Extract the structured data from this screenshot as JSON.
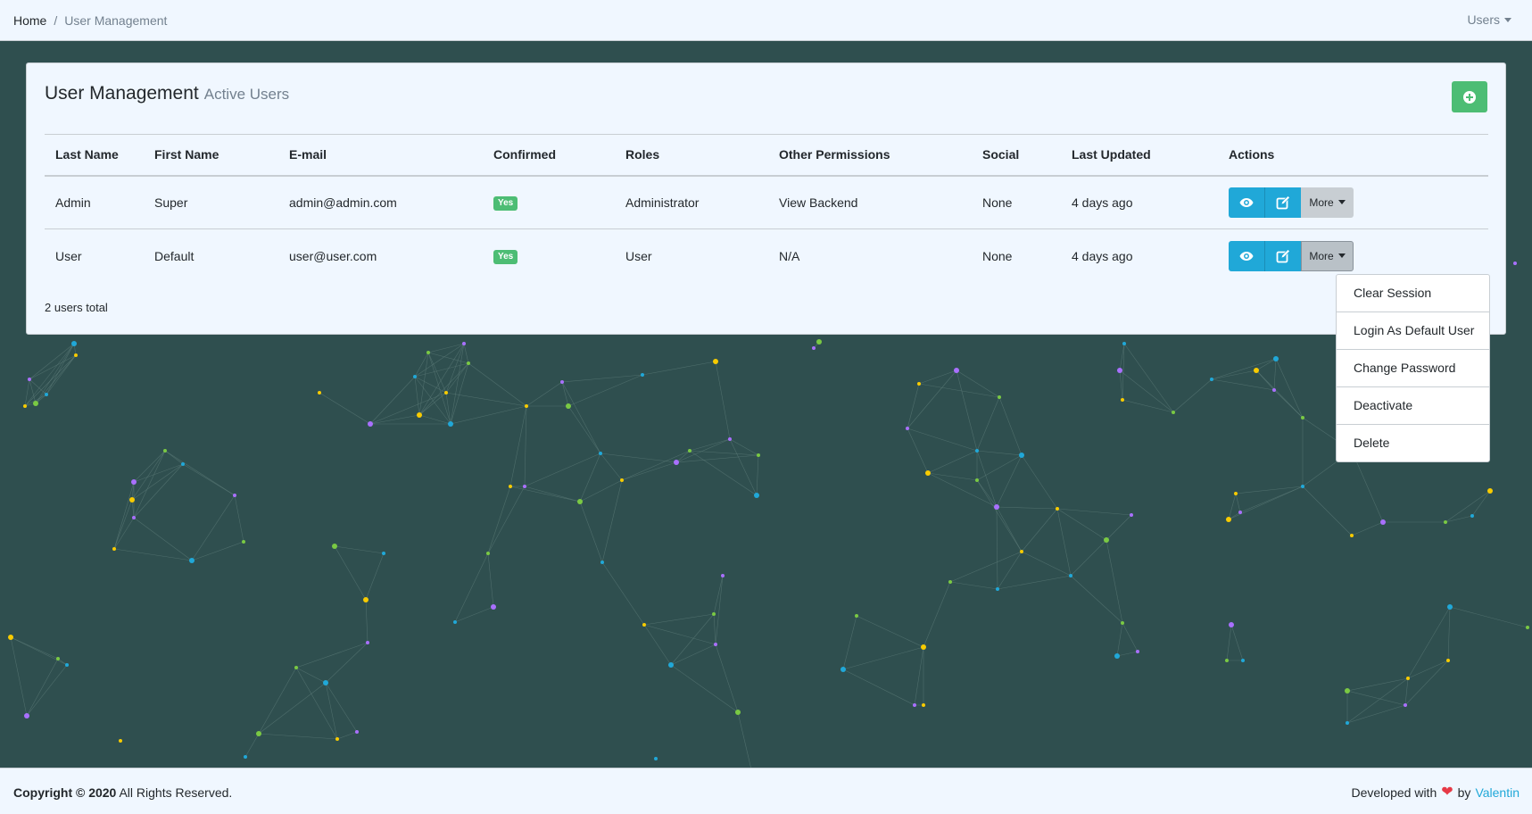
{
  "header": {
    "breadcrumb": {
      "home": "Home",
      "separator": "/",
      "current": "User Management"
    },
    "users_menu": "Users"
  },
  "card": {
    "title": "User Management",
    "subtitle": "Active Users",
    "add_button_icon": "plus-circle-icon",
    "total": "2 users total"
  },
  "table": {
    "headers": [
      "Last Name",
      "First Name",
      "E-mail",
      "Confirmed",
      "Roles",
      "Other Permissions",
      "Social",
      "Last Updated",
      "Actions"
    ],
    "rows": [
      {
        "last_name": "Admin",
        "first_name": "Super",
        "email": "admin@admin.com",
        "confirmed": "Yes",
        "roles": "Administrator",
        "other_permissions": "View Backend",
        "social": "None",
        "last_updated": "4 days ago",
        "more_label": "More"
      },
      {
        "last_name": "User",
        "first_name": "Default",
        "email": "user@user.com",
        "confirmed": "Yes",
        "roles": "User",
        "other_permissions": "N/A",
        "social": "None",
        "last_updated": "4 days ago",
        "more_label": "More"
      }
    ]
  },
  "dropdown": {
    "items": [
      "Clear Session",
      "Login As Default User",
      "Change Password",
      "Deactivate",
      "Delete"
    ]
  },
  "footer": {
    "copyright": "Copyright © 2020",
    "rights": "All Rights Reserved.",
    "developed_with": "Developed with",
    "by": "by",
    "author": "Valentin"
  },
  "colors": {
    "background": "#2f4f4f",
    "panel": "#f0f7ff",
    "success": "#4dbd74",
    "info": "#20a8d8",
    "secondary": "#c8ced3",
    "heart": "#e63946"
  }
}
